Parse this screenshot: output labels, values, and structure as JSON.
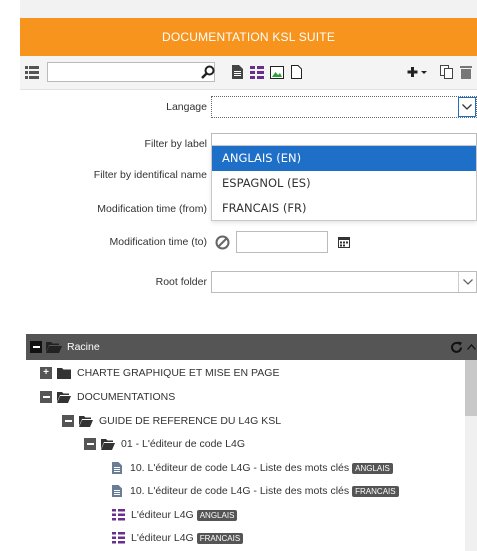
{
  "header": {
    "title": "DOCUMENTATION KSL SUITE"
  },
  "toolbar": {
    "search_value": ""
  },
  "form": {
    "langage_label": "Langage",
    "langage_value": "",
    "filter_label_label": "Filter by label",
    "filter_identifical_label": "Filter by identifical name",
    "mod_from_label": "Modification time (from)",
    "mod_to_label": "Modification time (to)",
    "root_folder_label": "Root folder"
  },
  "dropdown": {
    "options": [
      "ANGLAIS (EN)",
      "ESPAGNOL (ES)",
      "FRANCAIS (FR)"
    ],
    "selected_index": 0
  },
  "tree": {
    "root_label": "Racine",
    "nodes": [
      {
        "label": "CHARTE GRAPHIQUE ET MISE EN PAGE"
      },
      {
        "label": "DOCUMENTATIONS"
      },
      {
        "label": "GUIDE DE REFERENCE DU L4G KSL"
      },
      {
        "label": "01 - L'éditeur de code L4G"
      },
      {
        "label": "10. L'éditeur de code L4G - Liste des mots clés",
        "badge": "ANGLAIS"
      },
      {
        "label": "10. L'éditeur de code L4G - Liste des mots clés",
        "badge": "FRANCAIS"
      },
      {
        "label": "L'éditeur L4G",
        "badge": "ANGLAIS"
      },
      {
        "label": "L'éditeur L4G",
        "badge": "FRANCAIS"
      }
    ]
  },
  "colors": {
    "header_bg": "#f7941d",
    "selected_option": "#1e6fc8",
    "tree_header": "#555555"
  }
}
